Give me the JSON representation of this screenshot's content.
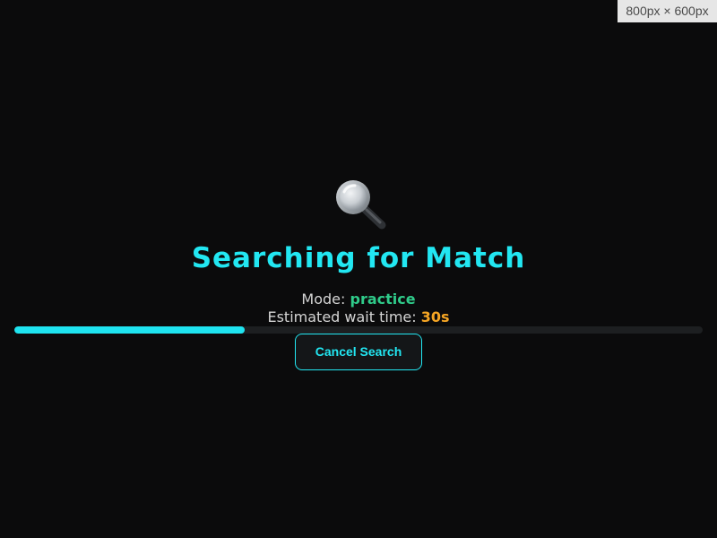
{
  "viewport_badge": "800px × 600px",
  "icon": "magnifying-glass-icon",
  "title": "Searching for Match",
  "mode": {
    "label": "Mode: ",
    "value": "practice"
  },
  "wait": {
    "label": "Estimated wait time: ",
    "value": "30s"
  },
  "progress": {
    "fraction": 0.335
  },
  "cancel_button": "Cancel Search",
  "colors": {
    "background": "#0b0b0c",
    "accent": "#22e7f2",
    "mode_value": "#2fcb8a",
    "wait_value": "#f5a524"
  }
}
